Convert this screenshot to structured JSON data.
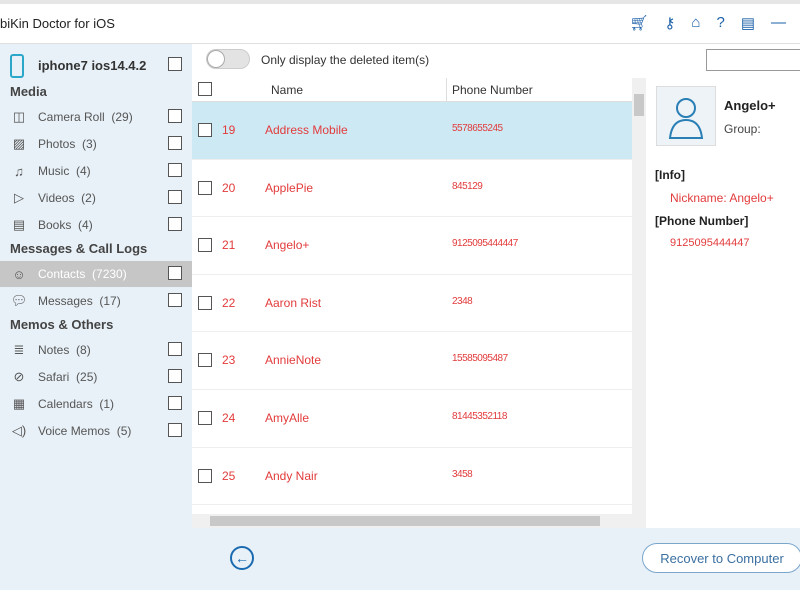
{
  "app": {
    "title": "biKin Doctor for iOS",
    "icons": [
      "cart-icon",
      "key-icon",
      "home-icon",
      "help-icon",
      "feedback-icon",
      "minimize-icon"
    ]
  },
  "sidebar": {
    "device": "iphone7 ios14.4.2",
    "sections": [
      {
        "title": "Media",
        "items": [
          {
            "label": "Camera Roll",
            "count": "(29)",
            "icon": "camera-icon"
          },
          {
            "label": "Photos",
            "count": "(3)",
            "icon": "photo-icon"
          },
          {
            "label": "Music",
            "count": "(4)",
            "icon": "music-icon"
          },
          {
            "label": "Videos",
            "count": "(2)",
            "icon": "video-icon"
          },
          {
            "label": "Books",
            "count": "(4)",
            "icon": "book-icon"
          }
        ]
      },
      {
        "title": "Messages & Call Logs",
        "items": [
          {
            "label": "Contacts",
            "count": "(7230)",
            "icon": "contact-icon",
            "active": true
          },
          {
            "label": "Messages",
            "count": "(17)",
            "icon": "message-icon"
          }
        ]
      },
      {
        "title": "Memos & Others",
        "items": [
          {
            "label": "Notes",
            "count": "(8)",
            "icon": "note-icon"
          },
          {
            "label": "Safari",
            "count": "(25)",
            "icon": "compass-icon"
          },
          {
            "label": "Calendars",
            "count": "(1)",
            "icon": "calendar-icon"
          },
          {
            "label": "Voice Memos",
            "count": "(5)",
            "icon": "speaker-icon"
          }
        ]
      }
    ]
  },
  "toolbar": {
    "toggle_label": "Only display the deleted item(s)",
    "search_placeholder": ""
  },
  "table": {
    "columns": [
      "Name",
      "Phone Number"
    ],
    "rows": [
      {
        "num": "19",
        "name": "Address Mobile",
        "phone": "5578655245",
        "selected": true
      },
      {
        "num": "20",
        "name": "ApplePie",
        "phone": "845129"
      },
      {
        "num": "21",
        "name": "Angelo+",
        "phone": "9125095444447"
      },
      {
        "num": "22",
        "name": "Aaron Rist",
        "phone": "2348"
      },
      {
        "num": "23",
        "name": "AnnieNote",
        "phone": "15585095487"
      },
      {
        "num": "24",
        "name": "AmyAlle",
        "phone": "81445352118"
      },
      {
        "num": "25",
        "name": "Andy Nair",
        "phone": "3458"
      }
    ]
  },
  "detail": {
    "name": "Angelo+",
    "group_label": "Group:",
    "info_header": "[Info]",
    "nickname_label": "Nickname:",
    "nickname": "Angelo+",
    "phone_header": "[Phone Number]",
    "phone": "9125095444447"
  },
  "footer": {
    "recover_label": "Recover to Computer"
  },
  "colors": {
    "accent": "#1a6ab0",
    "deleted": "#e23b3b",
    "selected_row": "#cde9f4",
    "sidebar_bg": "#e8f1f8"
  }
}
